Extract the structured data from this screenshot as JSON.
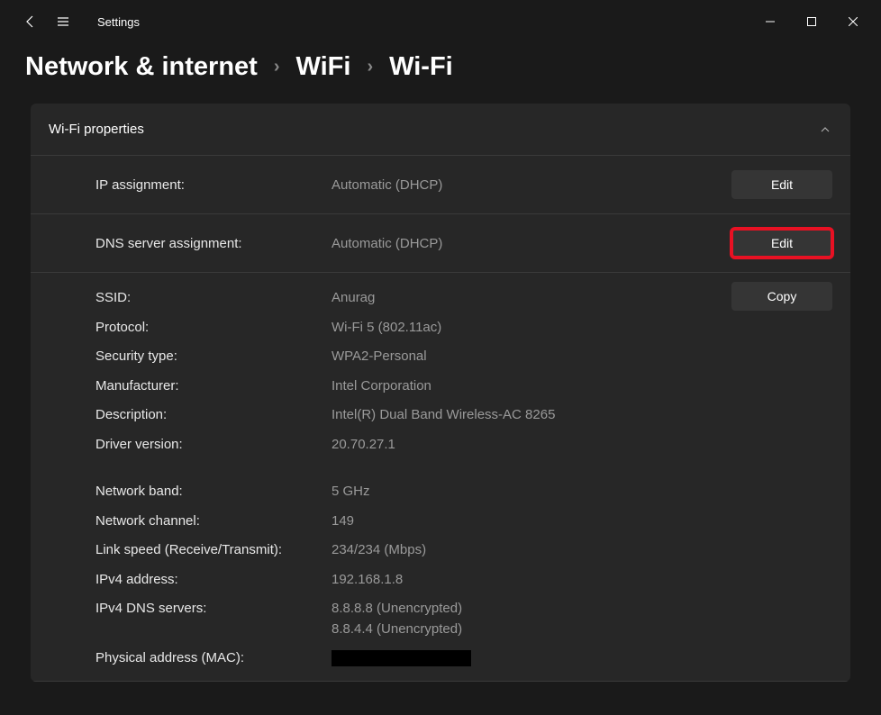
{
  "titlebar": {
    "title": "Settings"
  },
  "breadcrumb": {
    "crumb1": "Network & internet",
    "crumb2": "WiFi",
    "current": "Wi-Fi",
    "sep": "›"
  },
  "panel": {
    "title": "Wi-Fi properties"
  },
  "ipAssignment": {
    "label": "IP assignment:",
    "value": "Automatic (DHCP)",
    "button": "Edit"
  },
  "dnsAssignment": {
    "label": "DNS server assignment:",
    "value": "Automatic (DHCP)",
    "button": "Edit"
  },
  "copyButton": "Copy",
  "details1": {
    "ssid": {
      "k": "SSID:",
      "v": "Anurag"
    },
    "protocol": {
      "k": "Protocol:",
      "v": "Wi-Fi 5 (802.11ac)"
    },
    "security": {
      "k": "Security type:",
      "v": "WPA2-Personal"
    },
    "manufacturer": {
      "k": "Manufacturer:",
      "v": "Intel Corporation"
    },
    "description": {
      "k": "Description:",
      "v": "Intel(R) Dual Band Wireless-AC 8265"
    },
    "driver": {
      "k": "Driver version:",
      "v": "20.70.27.1"
    }
  },
  "details2": {
    "band": {
      "k": "Network band:",
      "v": "5 GHz"
    },
    "channel": {
      "k": "Network channel:",
      "v": "149"
    },
    "linkspeed": {
      "k": "Link speed (Receive/Transmit):",
      "v": "234/234 (Mbps)"
    },
    "ipv4": {
      "k": "IPv4 address:",
      "v": "192.168.1.8"
    },
    "dns": {
      "k": "IPv4 DNS servers:",
      "v1": "8.8.8.8 (Unencrypted)",
      "v2": "8.8.4.4 (Unencrypted)"
    },
    "mac": {
      "k": "Physical address (MAC):"
    }
  }
}
